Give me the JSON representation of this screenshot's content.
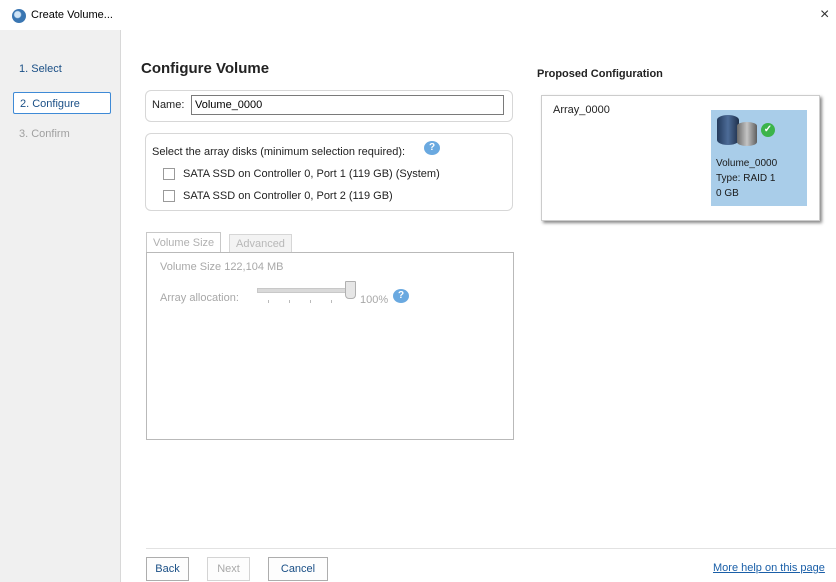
{
  "window": {
    "title": "Create Volume...",
    "close_glyph": "×",
    "icon": "app-volume-icon"
  },
  "steps": [
    {
      "label": "1. Select",
      "state": "done"
    },
    {
      "label": "2. Configure",
      "state": "active"
    },
    {
      "label": "3. Confirm",
      "state": "disabled"
    }
  ],
  "main": {
    "title": "Configure Volume",
    "name_label": "Name:",
    "name_value": "Volume_0000",
    "disks_label": "Select the array disks (minimum selection required):",
    "help_glyph": "?",
    "disks": [
      {
        "label": "SATA SSD on Controller 0, Port 1 (119 GB) (System)",
        "checked": false
      },
      {
        "label": "SATA SSD on Controller 0, Port 2 (119 GB)",
        "checked": false
      }
    ],
    "tabs": [
      {
        "label": "Volume Size",
        "active": true
      },
      {
        "label": "Advanced",
        "active": false
      }
    ],
    "volume_size": "Volume Size  122,104 MB",
    "alloc_label": "Array allocation:",
    "alloc_pct": "100%",
    "alloc_value": 100
  },
  "proposed": {
    "title": "Proposed Configuration",
    "array_label": "Array_0000",
    "volume_name": "Volume_0000",
    "volume_type": "Type: RAID 1",
    "volume_size": "0 GB",
    "card_color": "#a9cde9"
  },
  "footer": {
    "back": "Back",
    "next": "Next",
    "cancel": "Cancel",
    "help_link": "More help on this page"
  }
}
